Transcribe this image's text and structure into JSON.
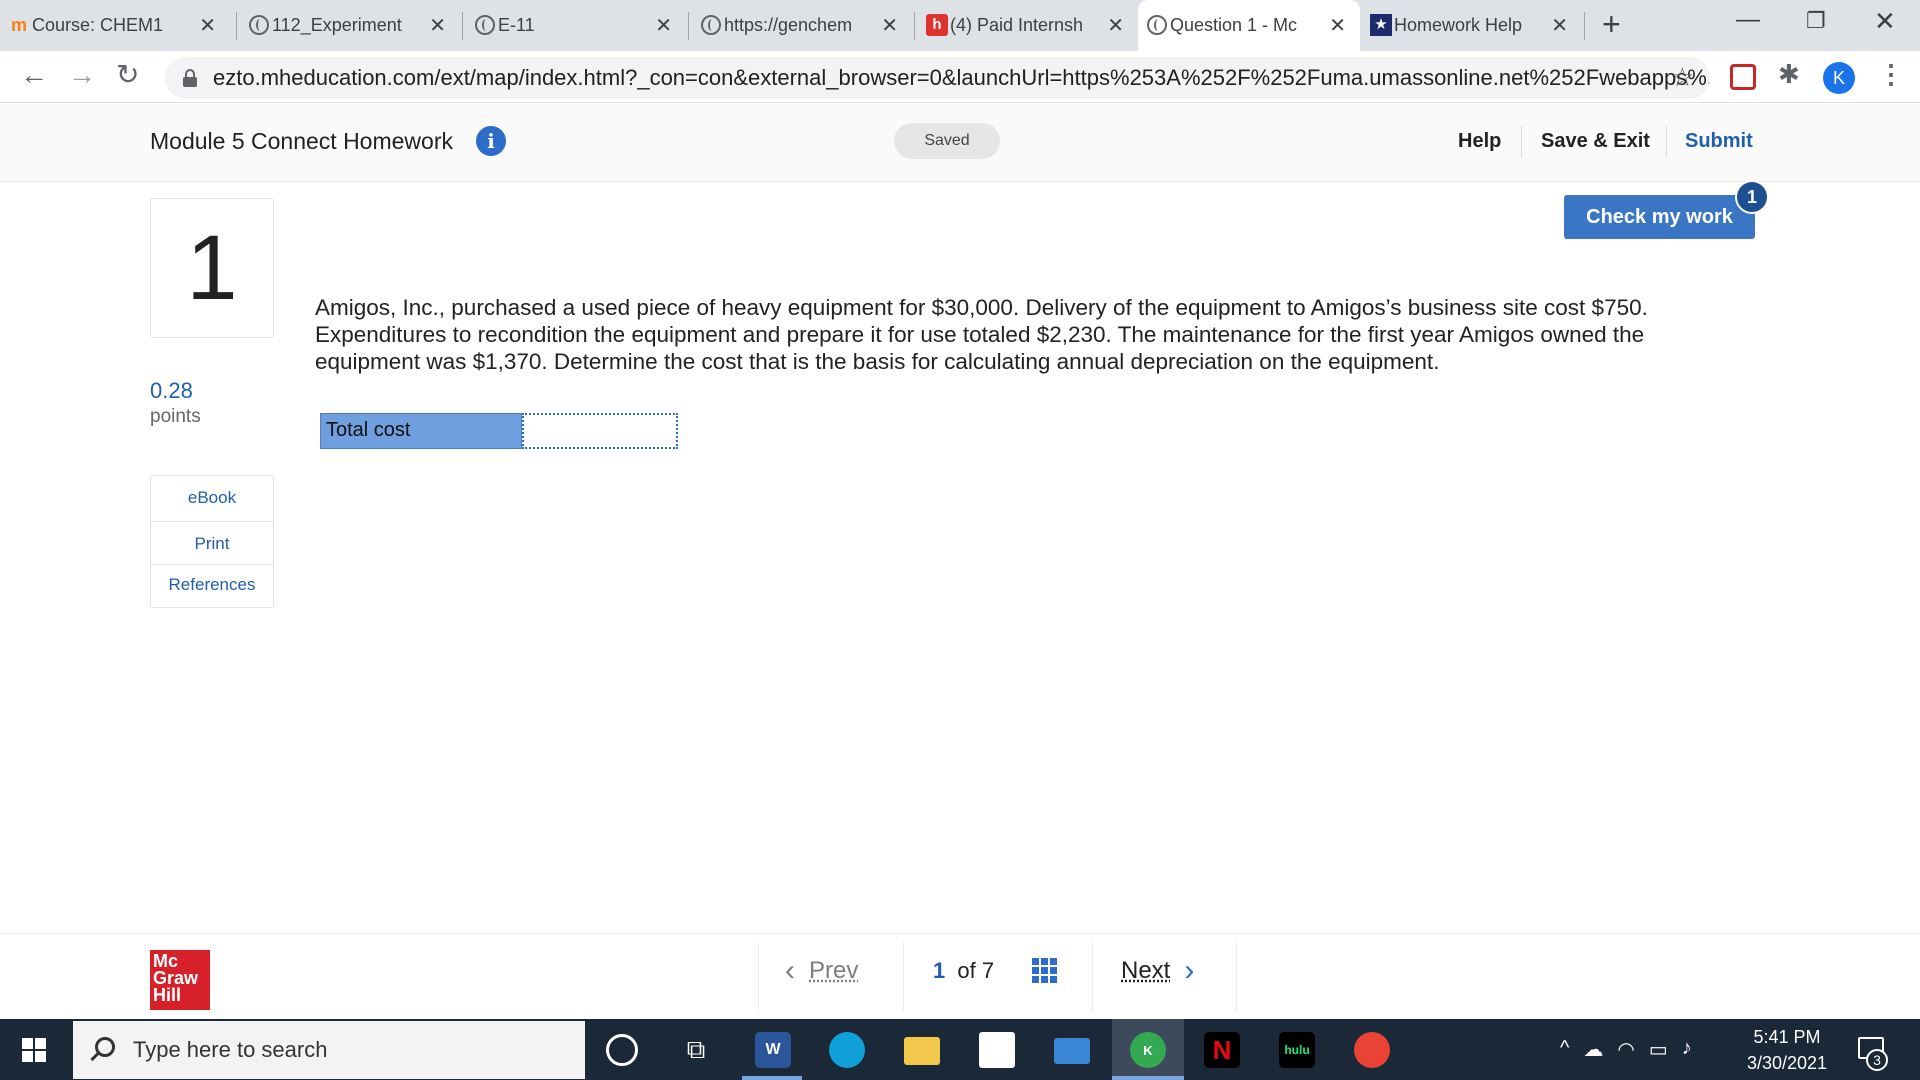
{
  "browser": {
    "tabs": [
      {
        "title": "Course: CHEM1",
        "icon": "moodle-icon"
      },
      {
        "title": "112_Experiment",
        "icon": "globe-icon"
      },
      {
        "title": "E-11",
        "icon": "globe-icon"
      },
      {
        "title": "https://genchem",
        "icon": "globe-icon"
      },
      {
        "title": "(4) Paid Internsh",
        "icon": "handshake-icon"
      },
      {
        "title": "Question 1 - Mc",
        "icon": "globe-icon",
        "active": true
      },
      {
        "title": "Homework Help",
        "icon": "star-badge-icon"
      }
    ],
    "url": "ezto.mheducation.com/ext/map/index.html?_con=con&external_browser=0&launchUrl=https%253A%252F%252Fuma.umassonline.net%252Fwebapps%...",
    "profile_initial": "K"
  },
  "header": {
    "title": "Module 5 Connect Homework",
    "saved_status": "Saved",
    "help_label": "Help",
    "save_exit_label": "Save & Exit",
    "submit_label": "Submit"
  },
  "question": {
    "number": "1",
    "points_value": "0.28",
    "points_label": "points",
    "resources": [
      "eBook",
      "Print",
      "References"
    ],
    "check_work_label": "Check my work",
    "check_work_count": "1",
    "text": "Amigos, Inc., purchased a used piece of heavy equipment for $30,000. Delivery of the equipment to Amigos’s business site cost $750. Expenditures to recondition the equipment and prepare it for use totaled $2,230. The maintenance for the first year Amigos owned the equipment was $1,370. Determine the cost that is the basis for calculating annual depreciation on the equipment.",
    "answer_label": "Total cost",
    "answer_value": ""
  },
  "footer": {
    "logo_lines": [
      "Mc",
      "Graw",
      "Hill"
    ],
    "prev_label": "Prev",
    "page_current": "1",
    "page_of": "of",
    "page_total": "7",
    "next_label": "Next"
  },
  "taskbar": {
    "search_placeholder": "Type here to search",
    "time": "5:41 PM",
    "date": "3/30/2021",
    "notification_count": "3",
    "app_labels": {
      "word": "W",
      "netflix": "N",
      "hulu": "hulu",
      "chrome_profile": "K"
    }
  },
  "colors": {
    "accent": "#3a76c4",
    "link": "#1f5fae",
    "mcgraw_red": "#d6202a",
    "answer_label_bg": "#6f9fdf",
    "taskbar": "#1b2838"
  }
}
